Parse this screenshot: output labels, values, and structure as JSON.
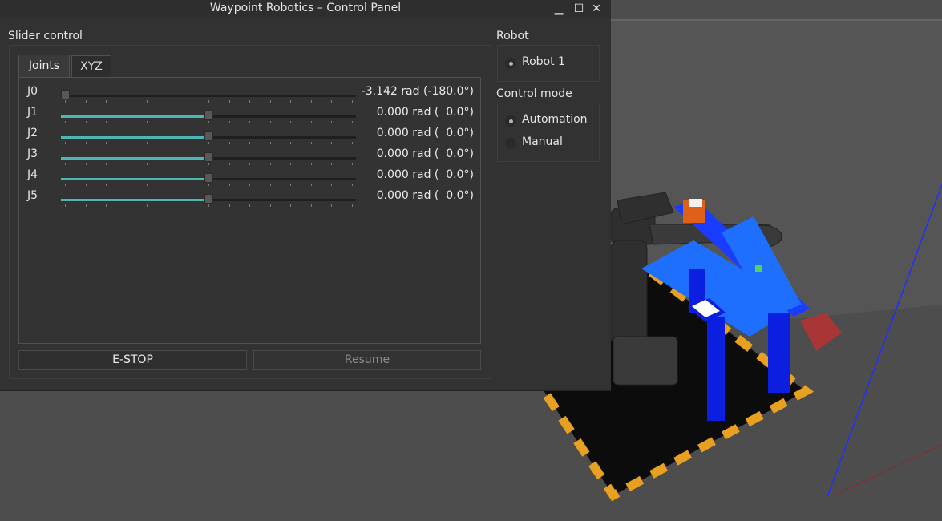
{
  "window": {
    "title": "Waypoint Robotics – Control Panel",
    "minimize": "▁",
    "maximize": "☐",
    "close": "✕"
  },
  "slider_control": {
    "label": "Slider control",
    "tabs": [
      {
        "label": "Joints",
        "selected": true
      },
      {
        "label": "XYZ",
        "selected": false
      }
    ],
    "joints": [
      {
        "name": "J0",
        "value_text": "-3.142 rad (-180.0°)",
        "position": 0.0
      },
      {
        "name": "J1",
        "value_text": "0.000 rad (  0.0°)",
        "position": 0.5
      },
      {
        "name": "J2",
        "value_text": "0.000 rad (  0.0°)",
        "position": 0.5
      },
      {
        "name": "J3",
        "value_text": "0.000 rad (  0.0°)",
        "position": 0.5
      },
      {
        "name": "J4",
        "value_text": "0.000 rad (  0.0°)",
        "position": 0.5
      },
      {
        "name": "J5",
        "value_text": "0.000 rad (  0.0°)",
        "position": 0.5
      }
    ],
    "estop_label": "E-STOP",
    "resume_label": "Resume"
  },
  "robot": {
    "label": "Robot",
    "options": [
      {
        "label": "Robot 1",
        "selected": true
      }
    ]
  },
  "control_mode": {
    "label": "Control mode",
    "options": [
      {
        "label": "Automation",
        "selected": true
      },
      {
        "label": "Manual",
        "selected": false
      }
    ]
  },
  "colors": {
    "slider_fill": "#4fb6b6",
    "table": "#1a3cff",
    "floor_marking": "#e8a020"
  }
}
